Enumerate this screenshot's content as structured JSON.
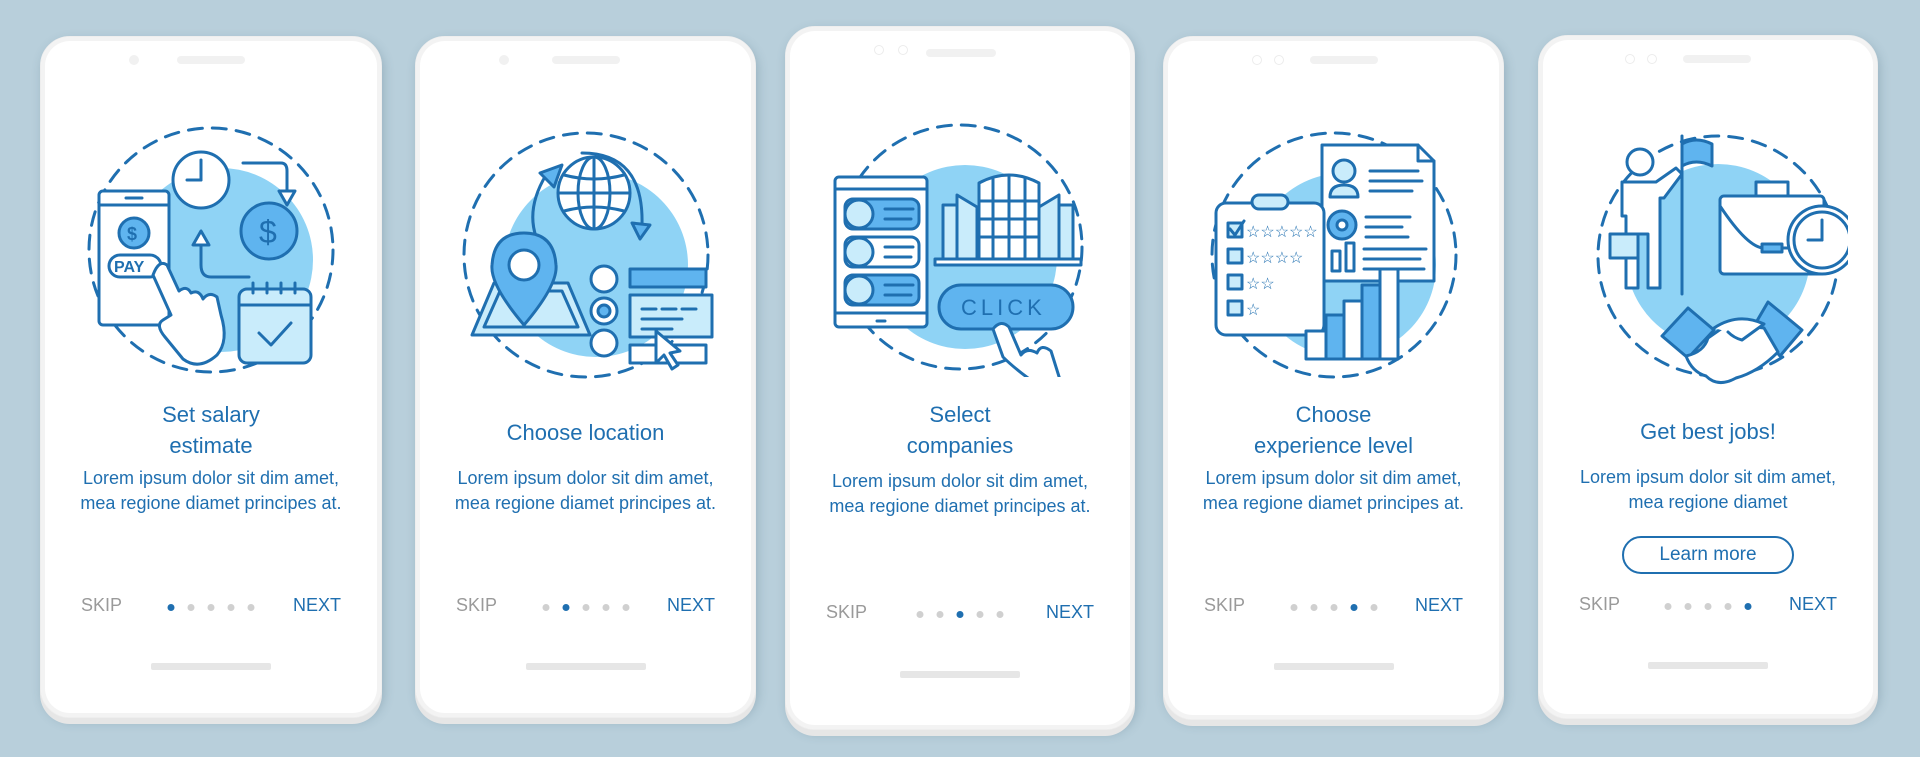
{
  "theme": {
    "background": "#b8cfdb",
    "accent": "#1f6fb0",
    "illustration_fill": "#8fd3f5",
    "muted": "#9a9a9a",
    "dot_inactive": "#d0d0d0"
  },
  "screens": [
    {
      "title_lines": [
        "Set salary",
        "estimate"
      ],
      "body": "Lorem ipsum dolor sit dim amet, mea regione diamet principes at.",
      "illustration": "salary-payment-icon",
      "illustration_labels": {
        "pay_button": "PAY",
        "currency": "$"
      },
      "skip_label": "SKIP",
      "next_label": "NEXT",
      "page_index": 1,
      "page_count": 5
    },
    {
      "title_lines": [
        "Choose location"
      ],
      "body": "Lorem ipsum dolor sit dim amet, mea regione diamet principes at.",
      "illustration": "location-globe-icon",
      "skip_label": "SKIP",
      "next_label": "NEXT",
      "page_index": 2,
      "page_count": 5
    },
    {
      "title_lines": [
        "Select",
        "companies"
      ],
      "body": "Lorem ipsum dolor sit dim amet, mea regione diamet principes at.",
      "illustration": "company-building-icon",
      "illustration_labels": {
        "click_button": "CLICK"
      },
      "skip_label": "SKIP",
      "next_label": "NEXT",
      "page_index": 3,
      "page_count": 5
    },
    {
      "title_lines": [
        "Choose",
        "experience level"
      ],
      "body": "Lorem ipsum dolor sit dim amet, mea regione diamet principes at.",
      "illustration": "experience-rating-icon",
      "skip_label": "SKIP",
      "next_label": "NEXT",
      "page_index": 4,
      "page_count": 5
    },
    {
      "title_lines": [
        "Get best jobs!"
      ],
      "body": "Lorem ipsum dolor sit dim amet, mea regione diamet",
      "illustration": "job-handshake-icon",
      "button_label": "Learn more",
      "skip_label": "SKIP",
      "next_label": "NEXT",
      "page_index": 5,
      "page_count": 5
    }
  ]
}
